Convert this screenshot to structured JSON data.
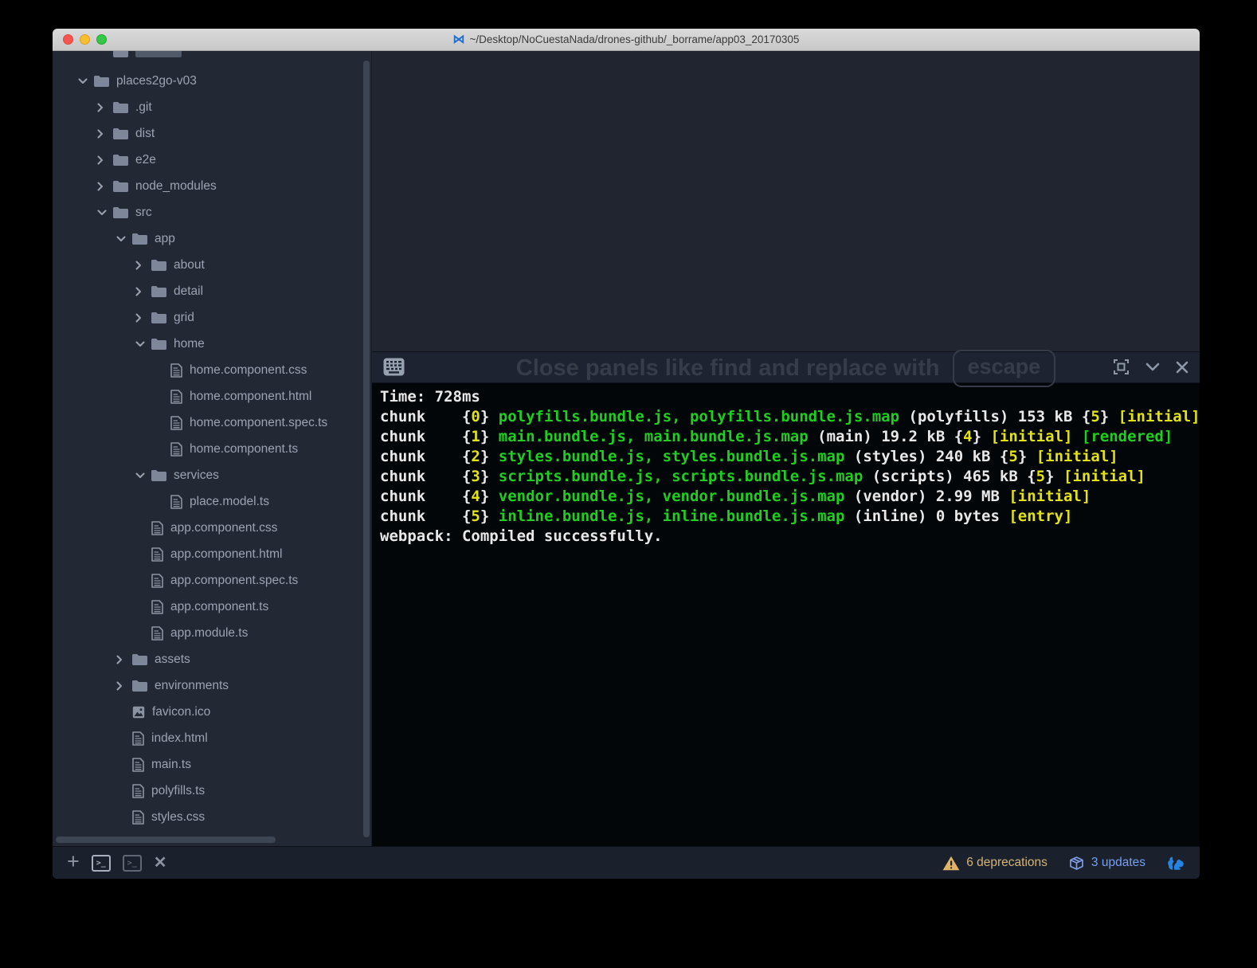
{
  "window": {
    "title": "~/Desktop/NoCuestaNada/drones-github/_borrame/app03_20170305",
    "proxy_icon": "bowtie-code-icon"
  },
  "colors": {
    "terminal_green": "#1fce1f",
    "terminal_yellow": "#e2e214",
    "terminal_white": "#e8e8e8",
    "deprecations_gold": "#d3b478",
    "updates_blue": "#759ff0",
    "squirrel_blue": "#2583e2",
    "tree_text": "#9ba3b2",
    "watermark_gray": "#363d49"
  },
  "tree": {
    "items": [
      {
        "label": "places2go-v03",
        "level": 0,
        "kind": "folder-open"
      },
      {
        "label": ".git",
        "level": 1,
        "kind": "folder-closed"
      },
      {
        "label": "dist",
        "level": 1,
        "kind": "folder-closed"
      },
      {
        "label": "e2e",
        "level": 1,
        "kind": "folder-closed"
      },
      {
        "label": "node_modules",
        "level": 1,
        "kind": "folder-closed"
      },
      {
        "label": "src",
        "level": 1,
        "kind": "folder-open"
      },
      {
        "label": "app",
        "level": 2,
        "kind": "folder-open"
      },
      {
        "label": "about",
        "level": 3,
        "kind": "folder-closed"
      },
      {
        "label": "detail",
        "level": 3,
        "kind": "folder-closed"
      },
      {
        "label": "grid",
        "level": 3,
        "kind": "folder-closed"
      },
      {
        "label": "home",
        "level": 3,
        "kind": "folder-open"
      },
      {
        "label": "home.component.css",
        "level": 4,
        "kind": "file"
      },
      {
        "label": "home.component.html",
        "level": 4,
        "kind": "file"
      },
      {
        "label": "home.component.spec.ts",
        "level": 4,
        "kind": "file"
      },
      {
        "label": "home.component.ts",
        "level": 4,
        "kind": "file"
      },
      {
        "label": "services",
        "level": 3,
        "kind": "folder-open"
      },
      {
        "label": "place.model.ts",
        "level": 4,
        "kind": "file"
      },
      {
        "label": "app.component.css",
        "level": 3,
        "kind": "file"
      },
      {
        "label": "app.component.html",
        "level": 3,
        "kind": "file"
      },
      {
        "label": "app.component.spec.ts",
        "level": 3,
        "kind": "file"
      },
      {
        "label": "app.component.ts",
        "level": 3,
        "kind": "file"
      },
      {
        "label": "app.module.ts",
        "level": 3,
        "kind": "file"
      },
      {
        "label": "assets",
        "level": 2,
        "kind": "folder-closed"
      },
      {
        "label": "environments",
        "level": 2,
        "kind": "folder-closed"
      },
      {
        "label": "favicon.ico",
        "level": 2,
        "kind": "image"
      },
      {
        "label": "index.html",
        "level": 2,
        "kind": "file"
      },
      {
        "label": "main.ts",
        "level": 2,
        "kind": "file"
      },
      {
        "label": "polyfills.ts",
        "level": 2,
        "kind": "file"
      },
      {
        "label": "styles.css",
        "level": 2,
        "kind": "file"
      }
    ]
  },
  "editor": {
    "watermark_text": "Close panels like find and replace with",
    "watermark_key": "escape"
  },
  "terminal": {
    "header_icons": [
      "keyboard-icon",
      "maximize-icon",
      "chevron-down-icon",
      "close-icon"
    ],
    "lines": [
      [
        [
          "Time: ",
          "w"
        ],
        [
          "728",
          "w"
        ],
        [
          "ms",
          "w"
        ]
      ],
      [
        [
          "chunk    ",
          "w"
        ],
        [
          "{",
          "w"
        ],
        [
          "0",
          "y"
        ],
        [
          "} ",
          "w"
        ],
        [
          "polyfills.bundle.js, polyfills.bundle.js.map",
          "g"
        ],
        [
          " (polyfills) 153 kB ",
          "w"
        ],
        [
          "{",
          "w"
        ],
        [
          "5",
          "y"
        ],
        [
          "} ",
          "w"
        ],
        [
          "[initial]",
          "y"
        ]
      ],
      [
        [
          "chunk    ",
          "w"
        ],
        [
          "{",
          "w"
        ],
        [
          "1",
          "y"
        ],
        [
          "} ",
          "w"
        ],
        [
          "main.bundle.js, main.bundle.js.map",
          "g"
        ],
        [
          " (main) 19.2 kB ",
          "w"
        ],
        [
          "{",
          "w"
        ],
        [
          "4",
          "y"
        ],
        [
          "} ",
          "w"
        ],
        [
          "[initial]",
          "y"
        ],
        [
          " ",
          "w"
        ],
        [
          "[rendered]",
          "g"
        ]
      ],
      [
        [
          "chunk    ",
          "w"
        ],
        [
          "{",
          "w"
        ],
        [
          "2",
          "y"
        ],
        [
          "} ",
          "w"
        ],
        [
          "styles.bundle.js, styles.bundle.js.map",
          "g"
        ],
        [
          " (styles) 240 kB ",
          "w"
        ],
        [
          "{",
          "w"
        ],
        [
          "5",
          "y"
        ],
        [
          "} ",
          "w"
        ],
        [
          "[initial]",
          "y"
        ]
      ],
      [
        [
          "chunk    ",
          "w"
        ],
        [
          "{",
          "w"
        ],
        [
          "3",
          "y"
        ],
        [
          "} ",
          "w"
        ],
        [
          "scripts.bundle.js, scripts.bundle.js.map",
          "g"
        ],
        [
          " (scripts) 465 kB ",
          "w"
        ],
        [
          "{",
          "w"
        ],
        [
          "5",
          "y"
        ],
        [
          "} ",
          "w"
        ],
        [
          "[initial]",
          "y"
        ]
      ],
      [
        [
          "chunk    ",
          "w"
        ],
        [
          "{",
          "w"
        ],
        [
          "4",
          "y"
        ],
        [
          "} ",
          "w"
        ],
        [
          "vendor.bundle.js, vendor.bundle.js.map",
          "g"
        ],
        [
          " (vendor) 2.99 MB ",
          "w"
        ],
        [
          "[initial]",
          "y"
        ]
      ],
      [
        [
          "chunk    ",
          "w"
        ],
        [
          "{",
          "w"
        ],
        [
          "5",
          "y"
        ],
        [
          "} ",
          "w"
        ],
        [
          "inline.bundle.js, inline.bundle.js.map",
          "g"
        ],
        [
          " (inline) 0 bytes ",
          "w"
        ],
        [
          "[entry]",
          "y"
        ]
      ],
      [
        [
          "webpack: Compiled successfully.",
          "w"
        ]
      ]
    ]
  },
  "statusbar": {
    "left_icons": [
      "plus-icon",
      "terminal-panel-icon-active",
      "terminal-panel-icon",
      "close-icon"
    ],
    "terminal_glyph": ">_",
    "deprecations_label": "6 deprecations",
    "updates_label": "3 updates",
    "right_icons": [
      "warning-triangle-icon",
      "package-icon",
      "squirrel-icon"
    ]
  }
}
